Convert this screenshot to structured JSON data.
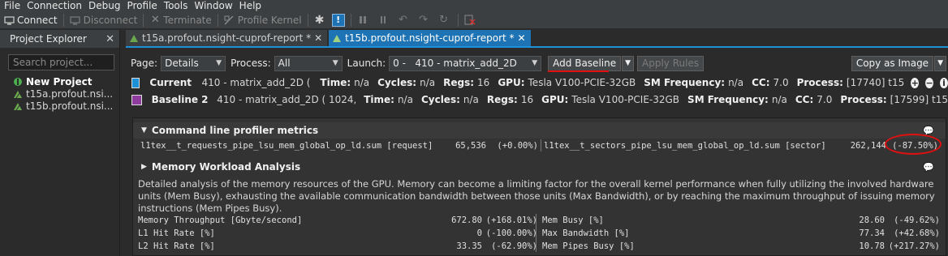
{
  "menu": [
    "File",
    "Connection",
    "Debug",
    "Profile",
    "Tools",
    "Window",
    "Help"
  ],
  "toolbar": {
    "connect": "Connect",
    "disconnect": "Disconnect",
    "terminate": "Terminate",
    "profile_kernel": "Profile Kernel"
  },
  "sidebar": {
    "title": "Project Explorer",
    "search_placeholder": "Search project...",
    "items": [
      {
        "label": "New Project"
      },
      {
        "label": "t15a.profout.nsi..."
      },
      {
        "label": "t15b.profout.nsi..."
      }
    ]
  },
  "tabs": [
    {
      "label": "t15a.profout.nsight-cuprof-report *"
    },
    {
      "label": "t15b.profout.nsight-cuprof-report *"
    }
  ],
  "controls": {
    "page_label": "Page:",
    "page_value": "Details",
    "process_label": "Process:",
    "process_value": "All",
    "launch_label": "Launch:",
    "launch_value": "0 -   410 - matrix_add_2D",
    "add_baseline": "Add Baseline",
    "apply_rules": "Apply Rules",
    "copy_as_image": "Copy as Image"
  },
  "results": [
    {
      "name": "Current",
      "color": "#1e90d8",
      "kernel": "410 - matrix_add_2D ( 1024, 10...",
      "time_k": "Time:",
      "time_v": "n/a",
      "cycles_k": "Cycles:",
      "cycles_v": "n/a",
      "regs_k": "Regs:",
      "regs_v": "16",
      "gpu_k": "GPU:",
      "gpu_v": "Tesla V100-PCIE-32GB",
      "smf_k": "SM Frequency:",
      "smf_v": "n/a",
      "cc_k": "CC:",
      "cc_v": "7.0",
      "proc_k": "Process:",
      "proc_v": "[17740] t15"
    },
    {
      "name": "Baseline 2",
      "color": "#8e3c9e",
      "kernel": "410 - matrix_add_2D ( 1024, 10...",
      "time_k": "Time:",
      "time_v": "n/a",
      "cycles_k": "Cycles:",
      "cycles_v": "n/a",
      "regs_k": "Regs:",
      "regs_v": "16",
      "gpu_k": "GPU:",
      "gpu_v": "Tesla V100-PCIE-32GB",
      "smf_k": "SM Frequency:",
      "smf_v": "n/a",
      "cc_k": "CC:",
      "cc_v": "7.0",
      "proc_k": "Process:",
      "proc_v": "[17599] t15"
    }
  ],
  "cmdline": {
    "title": "Command line profiler metrics",
    "m1_name": "l1tex__t_requests_pipe_lsu_mem_global_op_ld.sum [request]",
    "m1_value": "65,536",
    "m1_delta": "(+0.00%)",
    "m2_name": "l1tex__t_sectors_pipe_lsu_mem_global_op_ld.sum [sector]",
    "m2_value": "262,144",
    "m2_delta": "(-87.50%)"
  },
  "memory": {
    "title": "Memory Workload Analysis",
    "description": "Detailed analysis of the memory resources of the GPU. Memory can become a limiting factor for the overall kernel performance when fully utilizing the involved hardware units (Mem Busy), exhausting the available communication bandwidth between those units (Max Bandwidth), or by reaching the maximum throughput of issuing memory instructions (Mem Pipes Busy).",
    "rows": [
      {
        "l_name": "Memory Throughput [Gbyte/second]",
        "l_value": "672.80",
        "l_delta": "(+168.01%)",
        "r_name": "Mem Busy [%]",
        "r_value": "28.60",
        "r_delta": "(-49.62%)"
      },
      {
        "l_name": "L1 Hit Rate [%]",
        "l_value": "0",
        "l_delta": "(-100.00%)",
        "r_name": "Max Bandwidth [%]",
        "r_value": "77.34",
        "r_delta": "(+42.68%)"
      },
      {
        "l_name": "L2 Hit Rate [%]",
        "l_value": "33.35",
        "l_delta": "(-62.90%)",
        "r_name": "Mem Pipes Busy [%]",
        "r_value": "10.78",
        "r_delta": "(+217.27%)"
      }
    ]
  }
}
